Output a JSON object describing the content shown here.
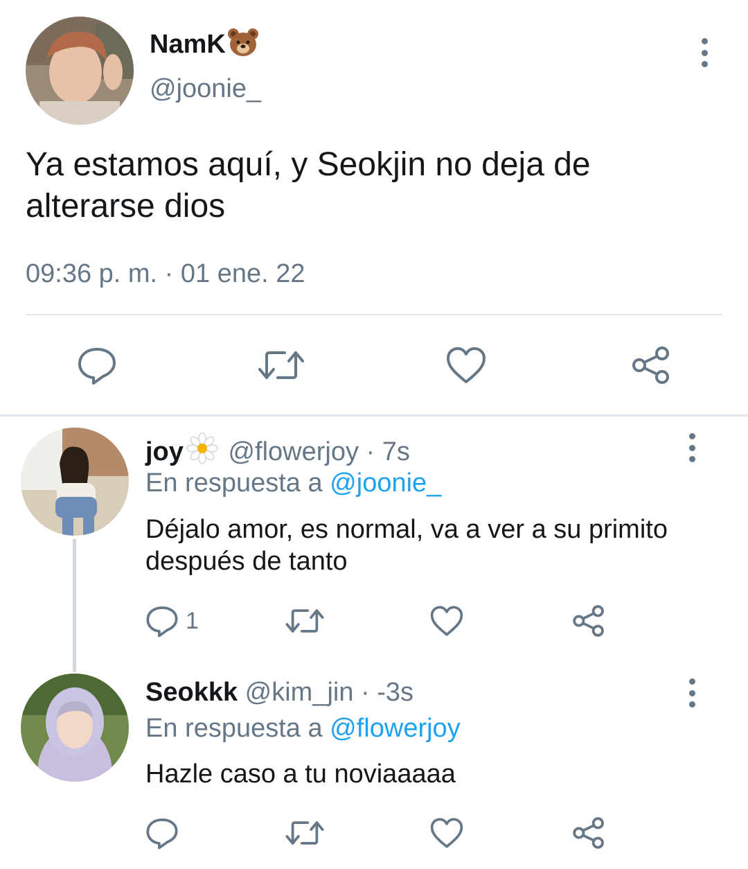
{
  "main_tweet": {
    "display_name": "NamK",
    "name_emoji": "bear-face-icon",
    "handle": "@joonie_",
    "text": "Ya estamos aquí, y Seokjin no deja de alterarse dios",
    "timestamp": "09:36 p. m. · 01 ene. 22",
    "actions": [
      "reply-icon",
      "retweet-icon",
      "like-icon",
      "share-icon"
    ]
  },
  "replies": [
    {
      "display_name": "joy",
      "name_emoji": "daisy-flower-icon",
      "meta": " @flowerjoy · 7s",
      "reply_prefix": "En respuesta a ",
      "reply_to": "@joonie_",
      "text": "Déjalo amor, es normal, va a ver a su primito después de tanto",
      "reply_count": "1"
    },
    {
      "display_name": "Seokkk",
      "meta": " @kim_jin · -3s",
      "reply_prefix": "En respuesta a ",
      "reply_to": "@flowerjoy",
      "text": "Hazle caso a tu noviaaaaa",
      "reply_count": ""
    }
  ],
  "colors": {
    "text": "#14171a",
    "secondary": "#657786",
    "link": "#1da1f2",
    "divider": "#e1e8ed"
  }
}
